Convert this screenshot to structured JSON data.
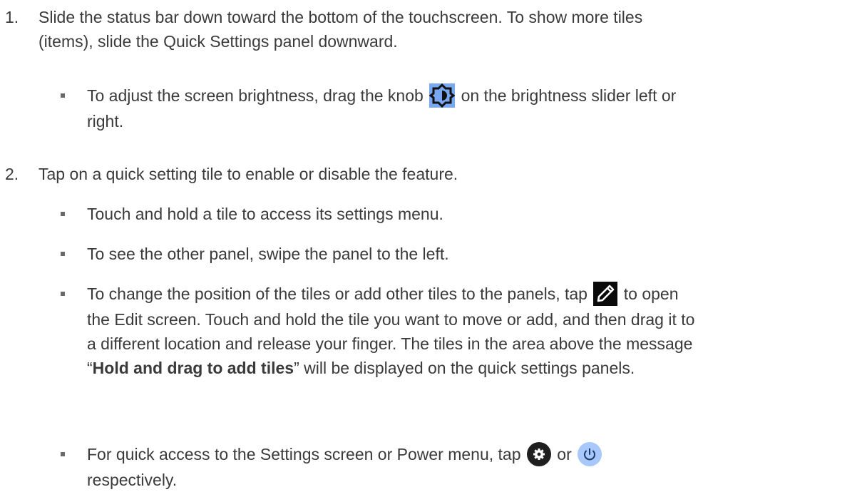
{
  "steps": [
    {
      "number": "1.",
      "lines": [
        "Slide the status bar down toward the bottom of the touchscreen. To show more tiles",
        "(items), slide the Quick Settings panel downward."
      ]
    },
    {
      "number": "2.",
      "lines": [
        "Tap on a quick setting tile to enable or disable the feature."
      ]
    }
  ],
  "bullets": {
    "brightness": {
      "before": "To adjust the screen brightness, drag the knob",
      "after": "on the brightness slider left or",
      "line2": "right.",
      "icon": "brightness-knob-icon"
    },
    "touch_hold": "Touch and hold a tile to access its settings menu.",
    "swipe": "To see the other panel, swipe the panel to the left.",
    "edit": {
      "before": "To change the position of the tiles or add other tiles to the panels, tap",
      "after": "to open",
      "line2": "the Edit screen. Touch and hold the tile you want to move or add, and then drag it to",
      "line3": "a different location and release your finger. The tiles in the area above the message",
      "line4_open_quote": "“",
      "line4_bold": "Hold and drag to add tiles",
      "line4_rest": "” will be displayed on the quick settings panels.",
      "icon": "pencil-edit-icon"
    },
    "quick_access": {
      "before": "For quick access to the Settings screen or Power menu, tap",
      "middle": "or",
      "line2": "respectively.",
      "icons": [
        "settings-gear-icon",
        "power-icon"
      ]
    }
  },
  "colors": {
    "text": "#3a3a3a",
    "brightness_icon_bg": "#79a8f2",
    "pencil_icon_bg": "#0a0a0a",
    "settings_icon_bg": "#1f1f1f",
    "power_icon_bg": "#a8c7fa"
  }
}
